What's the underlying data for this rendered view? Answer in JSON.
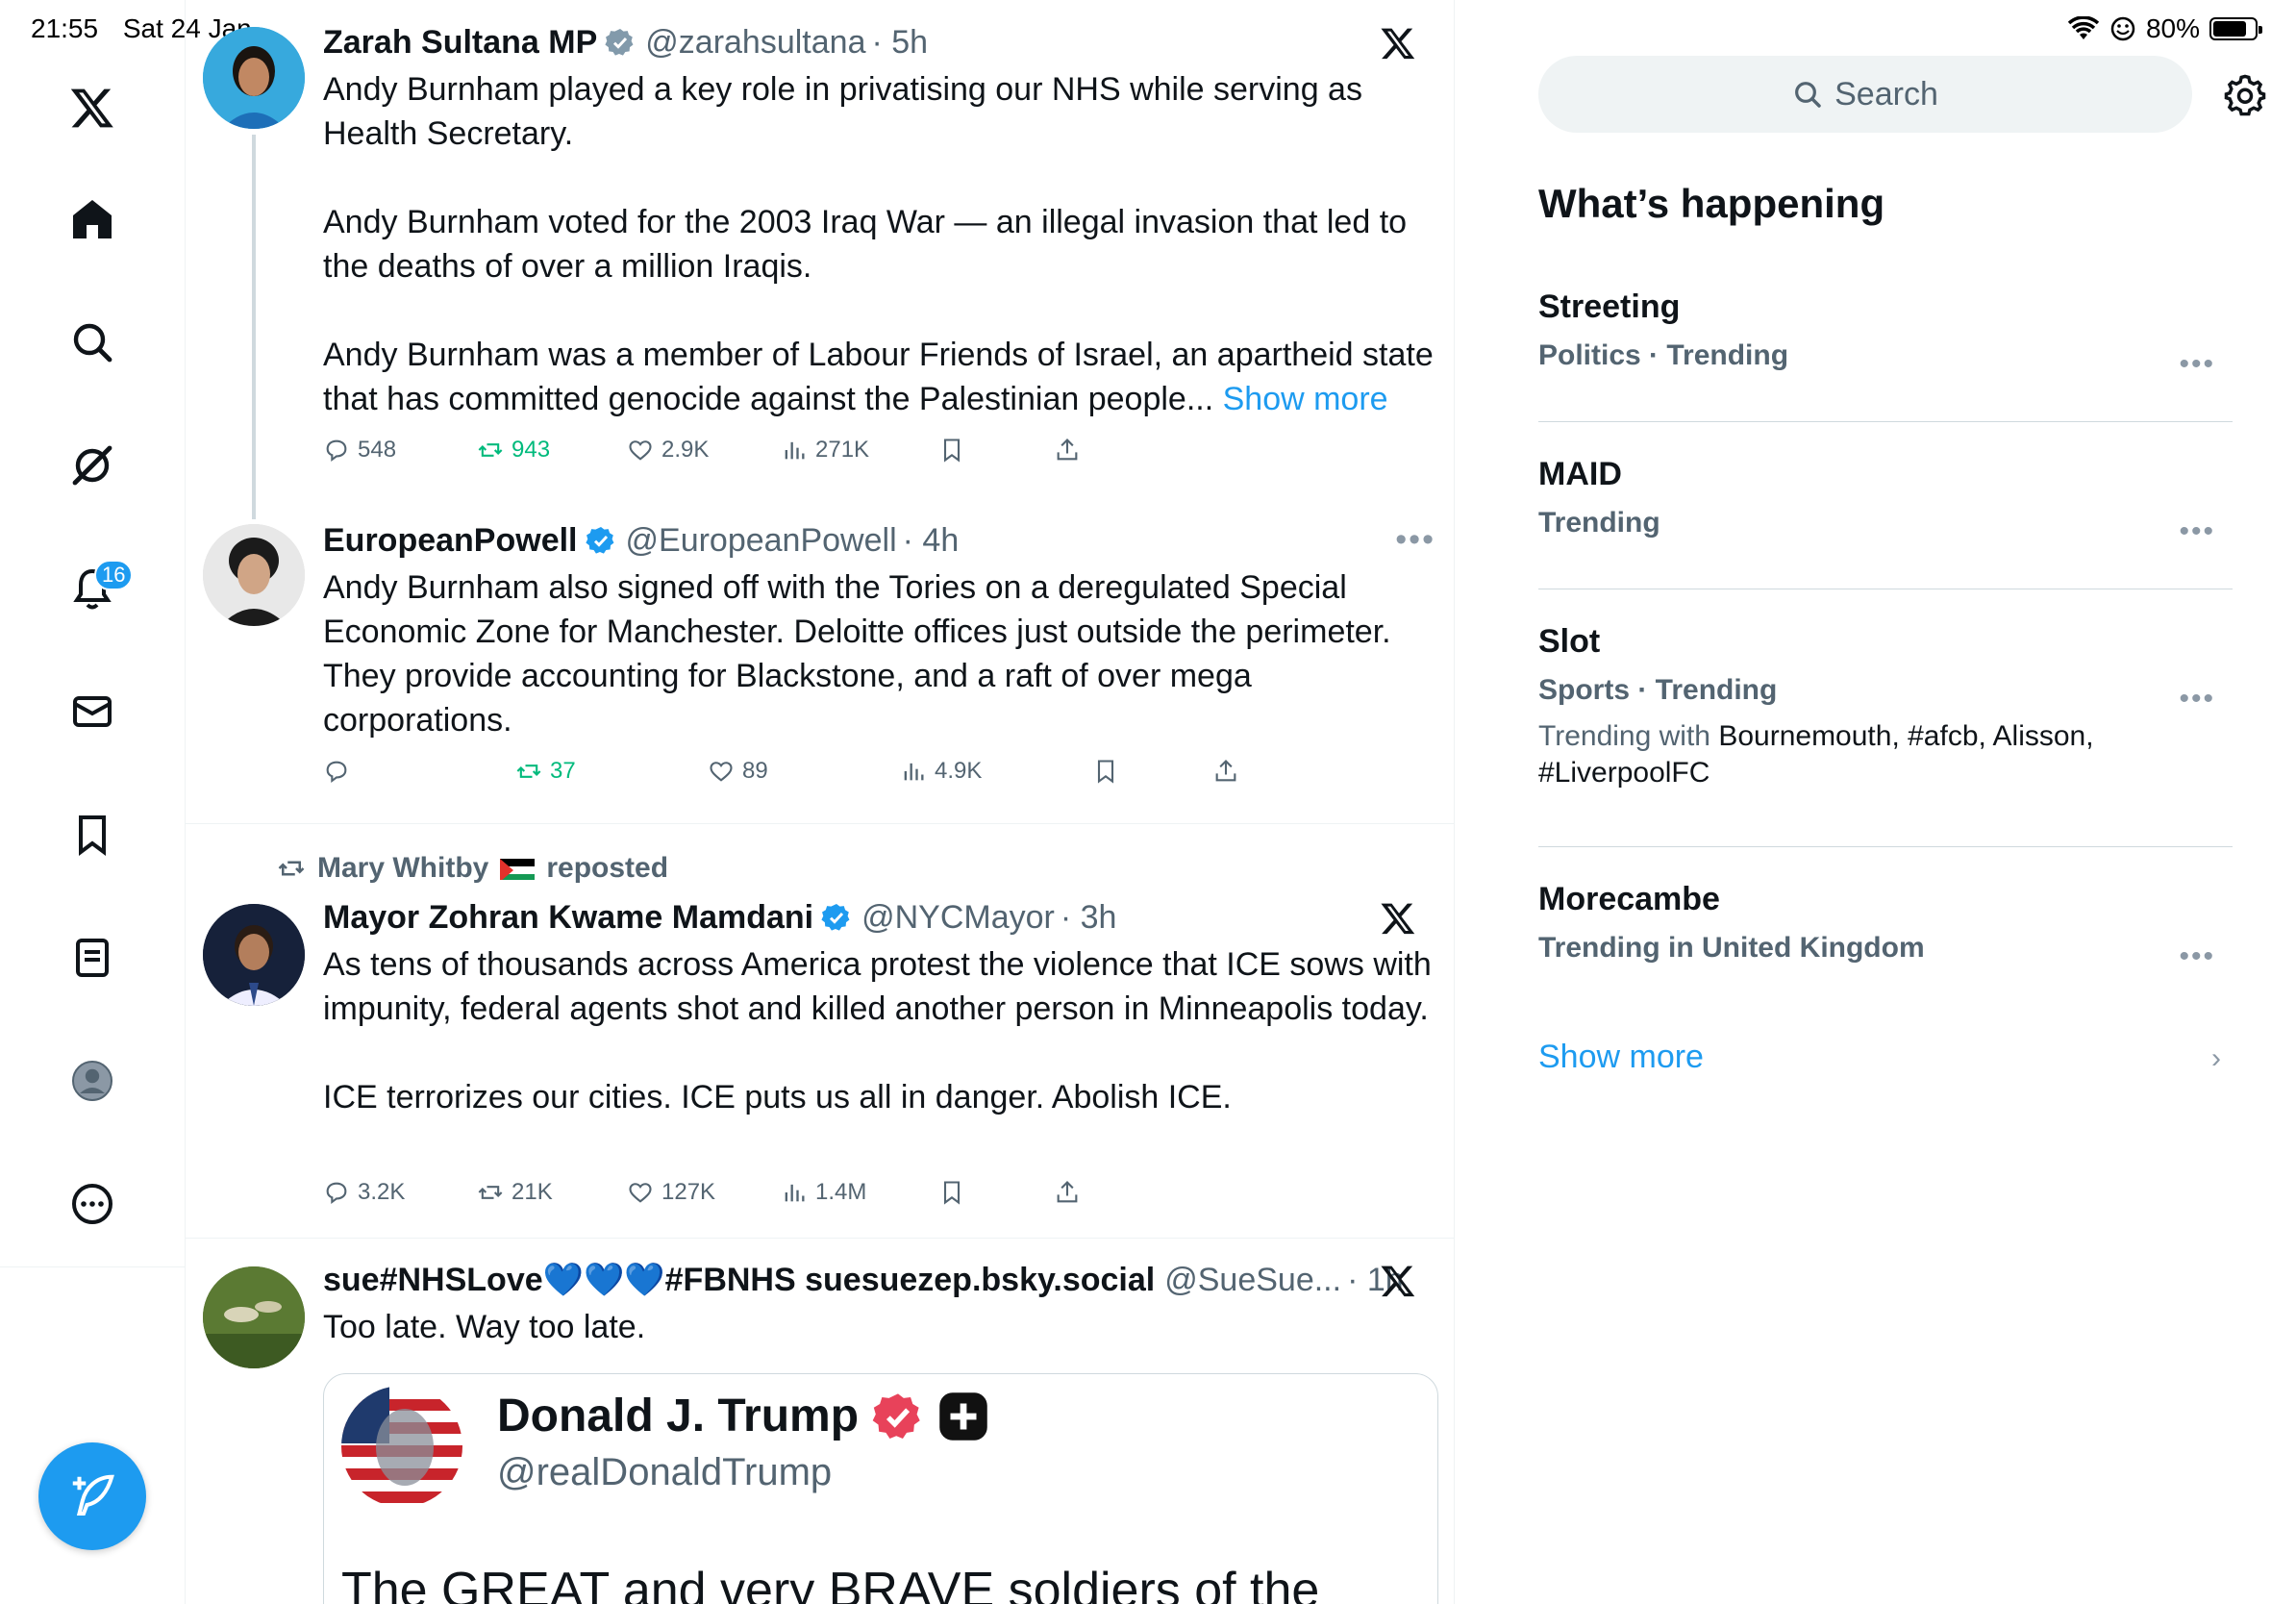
{
  "status_bar": {
    "time": "21:55",
    "date": "Sat 24 Jan",
    "battery": "80%",
    "battery_level": 0.8
  },
  "nav": {
    "items": [
      {
        "name": "x-logo-icon"
      },
      {
        "name": "home-icon"
      },
      {
        "name": "search-icon"
      },
      {
        "name": "grok-icon"
      },
      {
        "name": "notifications-icon"
      },
      {
        "name": "messages-icon"
      },
      {
        "name": "bookmarks-icon"
      },
      {
        "name": "lists-icon"
      },
      {
        "name": "profile-icon"
      },
      {
        "name": "more-icon"
      }
    ],
    "notifications_badge": "16"
  },
  "timeline": {
    "tweets": [
      {
        "name": "Zarah Sultana MP",
        "handle": "@zarahsultana",
        "time": "· 5h",
        "paragraphs": [
          "Andy Burnham played a key role in privatising our NHS while serving as Health Secretary.",
          "Andy Burnham voted for the 2003 Iraq War — an illegal invasion that led to the deaths of over a million Iraqis.",
          "Andy Burnham was a member of Labour Friends of Israel, an apartheid state that has committed genocide against the Palestinian people..."
        ],
        "show_more": "Show more",
        "replies": "548",
        "reposts": "943",
        "likes": "2.9K",
        "views": "271K"
      },
      {
        "name": "EuropeanPowell",
        "handle": "@EuropeanPowell",
        "time": "· 4h",
        "paragraphs": [
          "Andy Burnham also signed off with the Tories on a deregulated Special Economic Zone for Manchester. Deloitte offices just outside the perimeter. They provide accounting  for Blackstone, and a raft of over mega corporations."
        ],
        "replies": "",
        "reposts": "37",
        "likes": "89",
        "views": "4.9K"
      },
      {
        "repost_by": "Mary Whitby",
        "repost_label": "reposted",
        "name": "Mayor Zohran Kwame Mamdani",
        "handle": "@NYCMayor",
        "time": "· 3h",
        "paragraphs": [
          "As tens of thousands across America protest the violence that ICE sows with impunity, federal agents shot and killed another person in Minneapolis today.",
          "ICE terrorizes our cities. ICE puts us all in danger. Abolish ICE."
        ],
        "replies": "3.2K",
        "reposts": "21K",
        "likes": "127K",
        "views": "1.4M"
      },
      {
        "name": "sue#NHSLove💙💙💙#FBNHS suesuezep.bsky.social",
        "handle": "@SueSue...",
        "time": "· 1h",
        "paragraphs": [
          "Too late. Way too late."
        ],
        "quote": {
          "name": "Donald J. Trump",
          "handle": "@realDonaldTrump",
          "text": "The GREAT and very BRAVE soldiers of the"
        }
      }
    ]
  },
  "sidebar": {
    "search_placeholder": "Search",
    "title": "What’s happening",
    "trends": [
      {
        "name": "Streeting",
        "meta": "Politics · Trending"
      },
      {
        "name": "MAID",
        "meta": "Trending"
      },
      {
        "name": "Slot",
        "meta": "Sports · Trending",
        "with_label": "Trending with",
        "with_terms": "Bournemouth, #afcb, Alisson, #LiverpoolFC"
      },
      {
        "name": "Morecambe",
        "meta": "Trending in United Kingdom"
      }
    ],
    "show_more": "Show more",
    "more_glyph": "•••",
    "chevron_glyph": "›"
  },
  "colors": {
    "accent": "#1d9bf0",
    "repost_green": "#00ba7c",
    "text_primary": "#0f1419",
    "text_secondary": "#536471",
    "border": "#eff3f4"
  }
}
